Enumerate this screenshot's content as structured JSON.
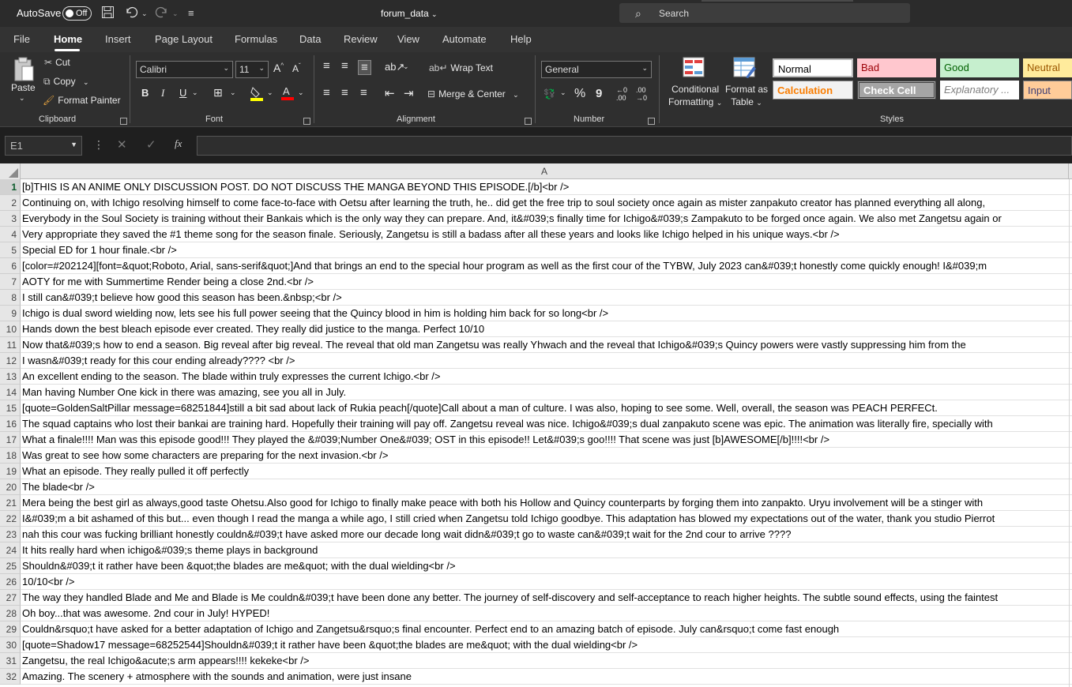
{
  "titlebar": {
    "autosave_label": "AutoSave",
    "autosave_state": "Off",
    "filename": "forum_data",
    "search_placeholder": "Search"
  },
  "menu": {
    "tabs": [
      "File",
      "Home",
      "Insert",
      "Page Layout",
      "Formulas",
      "Data",
      "Review",
      "View",
      "Automate",
      "Help"
    ],
    "active": "Home"
  },
  "ribbon": {
    "clipboard": {
      "paste": "Paste",
      "cut": "Cut",
      "copy": "Copy",
      "format_painter": "Format Painter",
      "label": "Clipboard"
    },
    "font": {
      "family": "Calibri",
      "size": "11",
      "label": "Font",
      "bold": "B",
      "italic": "I",
      "underline": "U"
    },
    "alignment": {
      "wrap": "Wrap Text",
      "merge": "Merge & Center",
      "label": "Alignment"
    },
    "number": {
      "format": "General",
      "label": "Number",
      "percent": "%",
      "comma": "9"
    },
    "conditional": {
      "line1": "Conditional",
      "line2": "Formatting"
    },
    "format_table": {
      "line1": "Format as",
      "line2": "Table"
    },
    "styles": {
      "label": "Styles",
      "items": [
        {
          "name": "Normal",
          "bg": "#ffffff",
          "fg": "#000000"
        },
        {
          "name": "Bad",
          "bg": "#ffc7ce",
          "fg": "#9c0006"
        },
        {
          "name": "Good",
          "bg": "#c6efce",
          "fg": "#006100"
        },
        {
          "name": "Neutral",
          "bg": "#ffeb9c",
          "fg": "#9c5700"
        },
        {
          "name": "Calculation",
          "bg": "#f2f2f2",
          "fg": "#fa7d00"
        },
        {
          "name": "Check Cell",
          "bg": "#a5a5a5",
          "fg": "#ffffff"
        },
        {
          "name": "Explanatory ...",
          "bg": "#ffffff",
          "fg": "#7f7f7f"
        },
        {
          "name": "Input",
          "bg": "#ffcc99",
          "fg": "#3f3f76"
        }
      ]
    }
  },
  "formula_bar": {
    "cell_ref": "E1",
    "fx": "fx",
    "value": ""
  },
  "sheet": {
    "column": "A",
    "rows": [
      "[b]THIS IS AN ANIME ONLY DISCUSSION POST. DO NOT DISCUSS THE MANGA BEYOND THIS EPISODE.[/b]<br />",
      "Continuing on, with Ichigo resolving himself to come face-to-face with Oetsu after learning the truth, he.. did get the free trip to soul society once again as mister zanpakuto creator has planned everything all along,",
      "Everybody in the Soul Society is training without their Bankais which is the only way they can prepare. And, it&#039;s finally time for Ichigo&#039;s Zampakuto to be forged once again. We also met Zangetsu again or",
      "Very appropriate they saved the #1 theme song for the season finale. Seriously, Zangetsu is still a badass after all these years and looks like Ichigo helped in his unique ways.<br />",
      "Special ED for 1 hour finale.<br />",
      "[color=#202124][font=&quot;Roboto, Arial, sans-serif&quot;]And that brings an end to the special hour program as well as the first cour of the TYBW, July 2023 can&#039;t honestly come quickly enough! I&#039;m",
      "AOTY for me with Summertime Render being a close 2nd.<br />",
      "I still can&#039;t believe how good this season has been.&nbsp;<br />",
      "Ichigo is dual sword wielding now, lets see his full power seeing that the Quincy blood in him is holding him back for so long<br />",
      "Hands down the best bleach episode ever created. They really did justice to the manga. Perfect 10/10",
      "Now that&#039;s how to end a season. Big reveal after big reveal. The reveal that old man Zangetsu was really Yhwach and the reveal that Ichigo&#039;s Quincy powers were vastly suppressing him from the",
      "I wasn&#039;t ready for this cour ending already???? <br />",
      "An excellent ending to the season. The blade within truly expresses the current Ichigo.<br />",
      "Man having Number One kick in there was amazing, see you all in July.",
      "[quote=GoldenSaltPillar message=68251844]still a bit sad about lack of Rukia peach[/quote]Call about a man of culture. I was also, hoping to see some. Well, overall, the season was PEACH PERFECt.",
      "The squad captains who lost their bankai are training hard. Hopefully their training will pay off. Zangetsu reveal was nice. Ichigo&#039;s dual zanpakuto scene was epic. The animation was literally fire, specially with",
      "What a finale!!!! Man was this episode good!!! They played the &#039;Number One&#039; OST in this episode!! Let&#039;s goo!!!! That scene was just [b]AWESOME[/b]!!!!<br />",
      "Was great to see how some characters are preparing for the next invasion.<br />",
      "What an episode. They really pulled it off perfectly",
      "The blade<br />",
      "Mera being the best girl as always,good taste Ohetsu.Also good for Ichigo to finally make peace with both his Hollow and Quincy counterparts by forging them into zanpakto. Uryu involvement will be a stinger with",
      "I&#039;m a bit ashamed of this but... even though I read the manga a while ago, I still cried when Zangetsu told Ichigo goodbye. This adaptation has blowed my expectations out of the water, thank you studio Pierrot",
      "nah this cour was fucking brilliant honestly couldn&#039;t have asked more our decade long wait didn&#039;t go to waste can&#039;t wait for the 2nd cour to arrive ????",
      "It hits really hard when ichigo&#039;s theme plays in background",
      "Shouldn&#039;t it rather have been &quot;the blades are me&quot; with the dual wielding<br />",
      "10/10<br />",
      "The way they handled Blade and Me and Blade is Me couldn&#039;t have been done any better. The journey of self-discovery and self-acceptance to reach higher heights. The subtle sound effects, using the faintest",
      "Oh boy...that was awesome. 2nd cour in July! HYPED!",
      "Couldn&rsquo;t have asked for a better adaptation of Ichigo and Zangetsu&rsquo;s final encounter. Perfect end to an amazing batch of episode. July can&rsquo;t come fast enough",
      "[quote=Shadow17 message=68252544]Shouldn&#039;t it rather have been &quot;the blades are me&quot; with the dual wielding<br />",
      "Zangetsu, the real Ichigo&acute;s arm appears!!!! kekeke<br />",
      "Amazing. The scenery + atmosphere with the sounds and animation, were just insane"
    ]
  }
}
